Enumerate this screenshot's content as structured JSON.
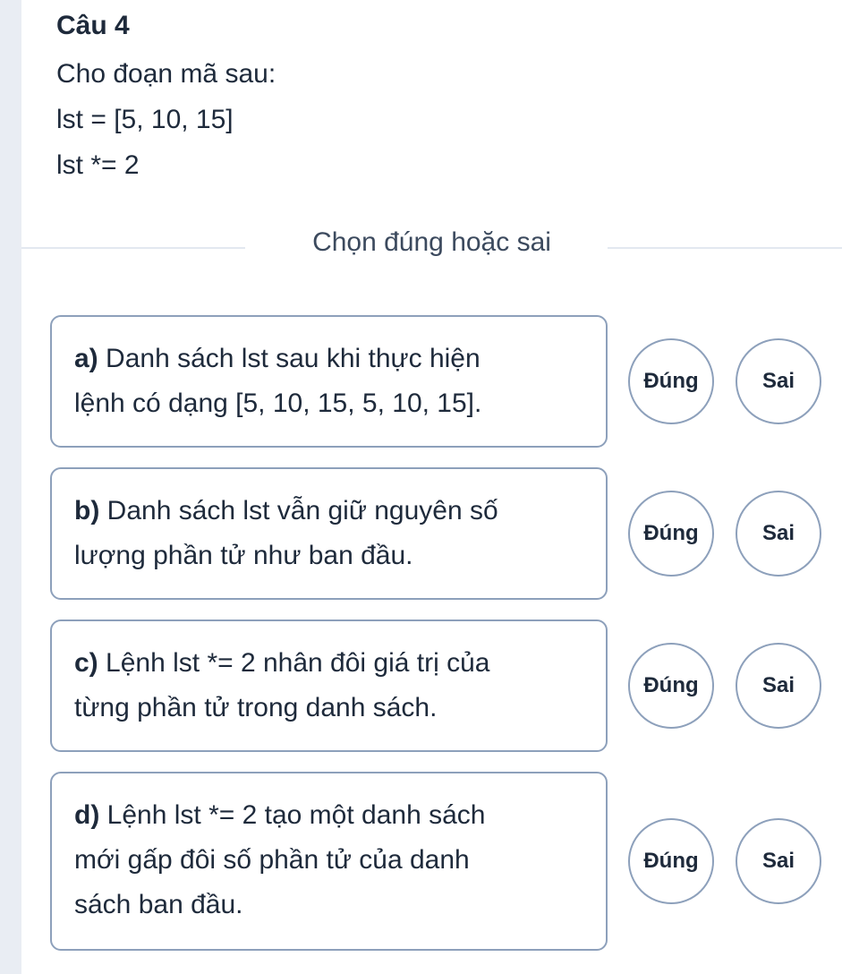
{
  "question": {
    "title": "Câu 4",
    "intro": "Cho đoạn mã sau:",
    "code": [
      "lst = [5, 10, 15]",
      "lst *= 2"
    ]
  },
  "section_label": "Chọn đúng hoặc sai",
  "choices": {
    "true_label": "Đúng",
    "false_label": "Sai"
  },
  "statements": [
    {
      "letter": "a)",
      "lines": [
        "Danh sách lst sau khi thực hiện",
        "lệnh có dạng [5, 10, 15, 5, 10, 15]."
      ]
    },
    {
      "letter": "b)",
      "lines": [
        "Danh sách lst vẫn giữ nguyên số",
        "lượng phần tử như ban đầu."
      ]
    },
    {
      "letter": "c)",
      "lines": [
        "Lệnh lst *= 2 nhân đôi giá trị của",
        "từng phần tử trong danh sách."
      ]
    },
    {
      "letter": "d)",
      "lines": [
        "Lệnh lst *= 2 tạo một danh sách",
        "mới gấp đôi số phần tử của danh",
        "sách ban đầu."
      ]
    }
  ]
}
